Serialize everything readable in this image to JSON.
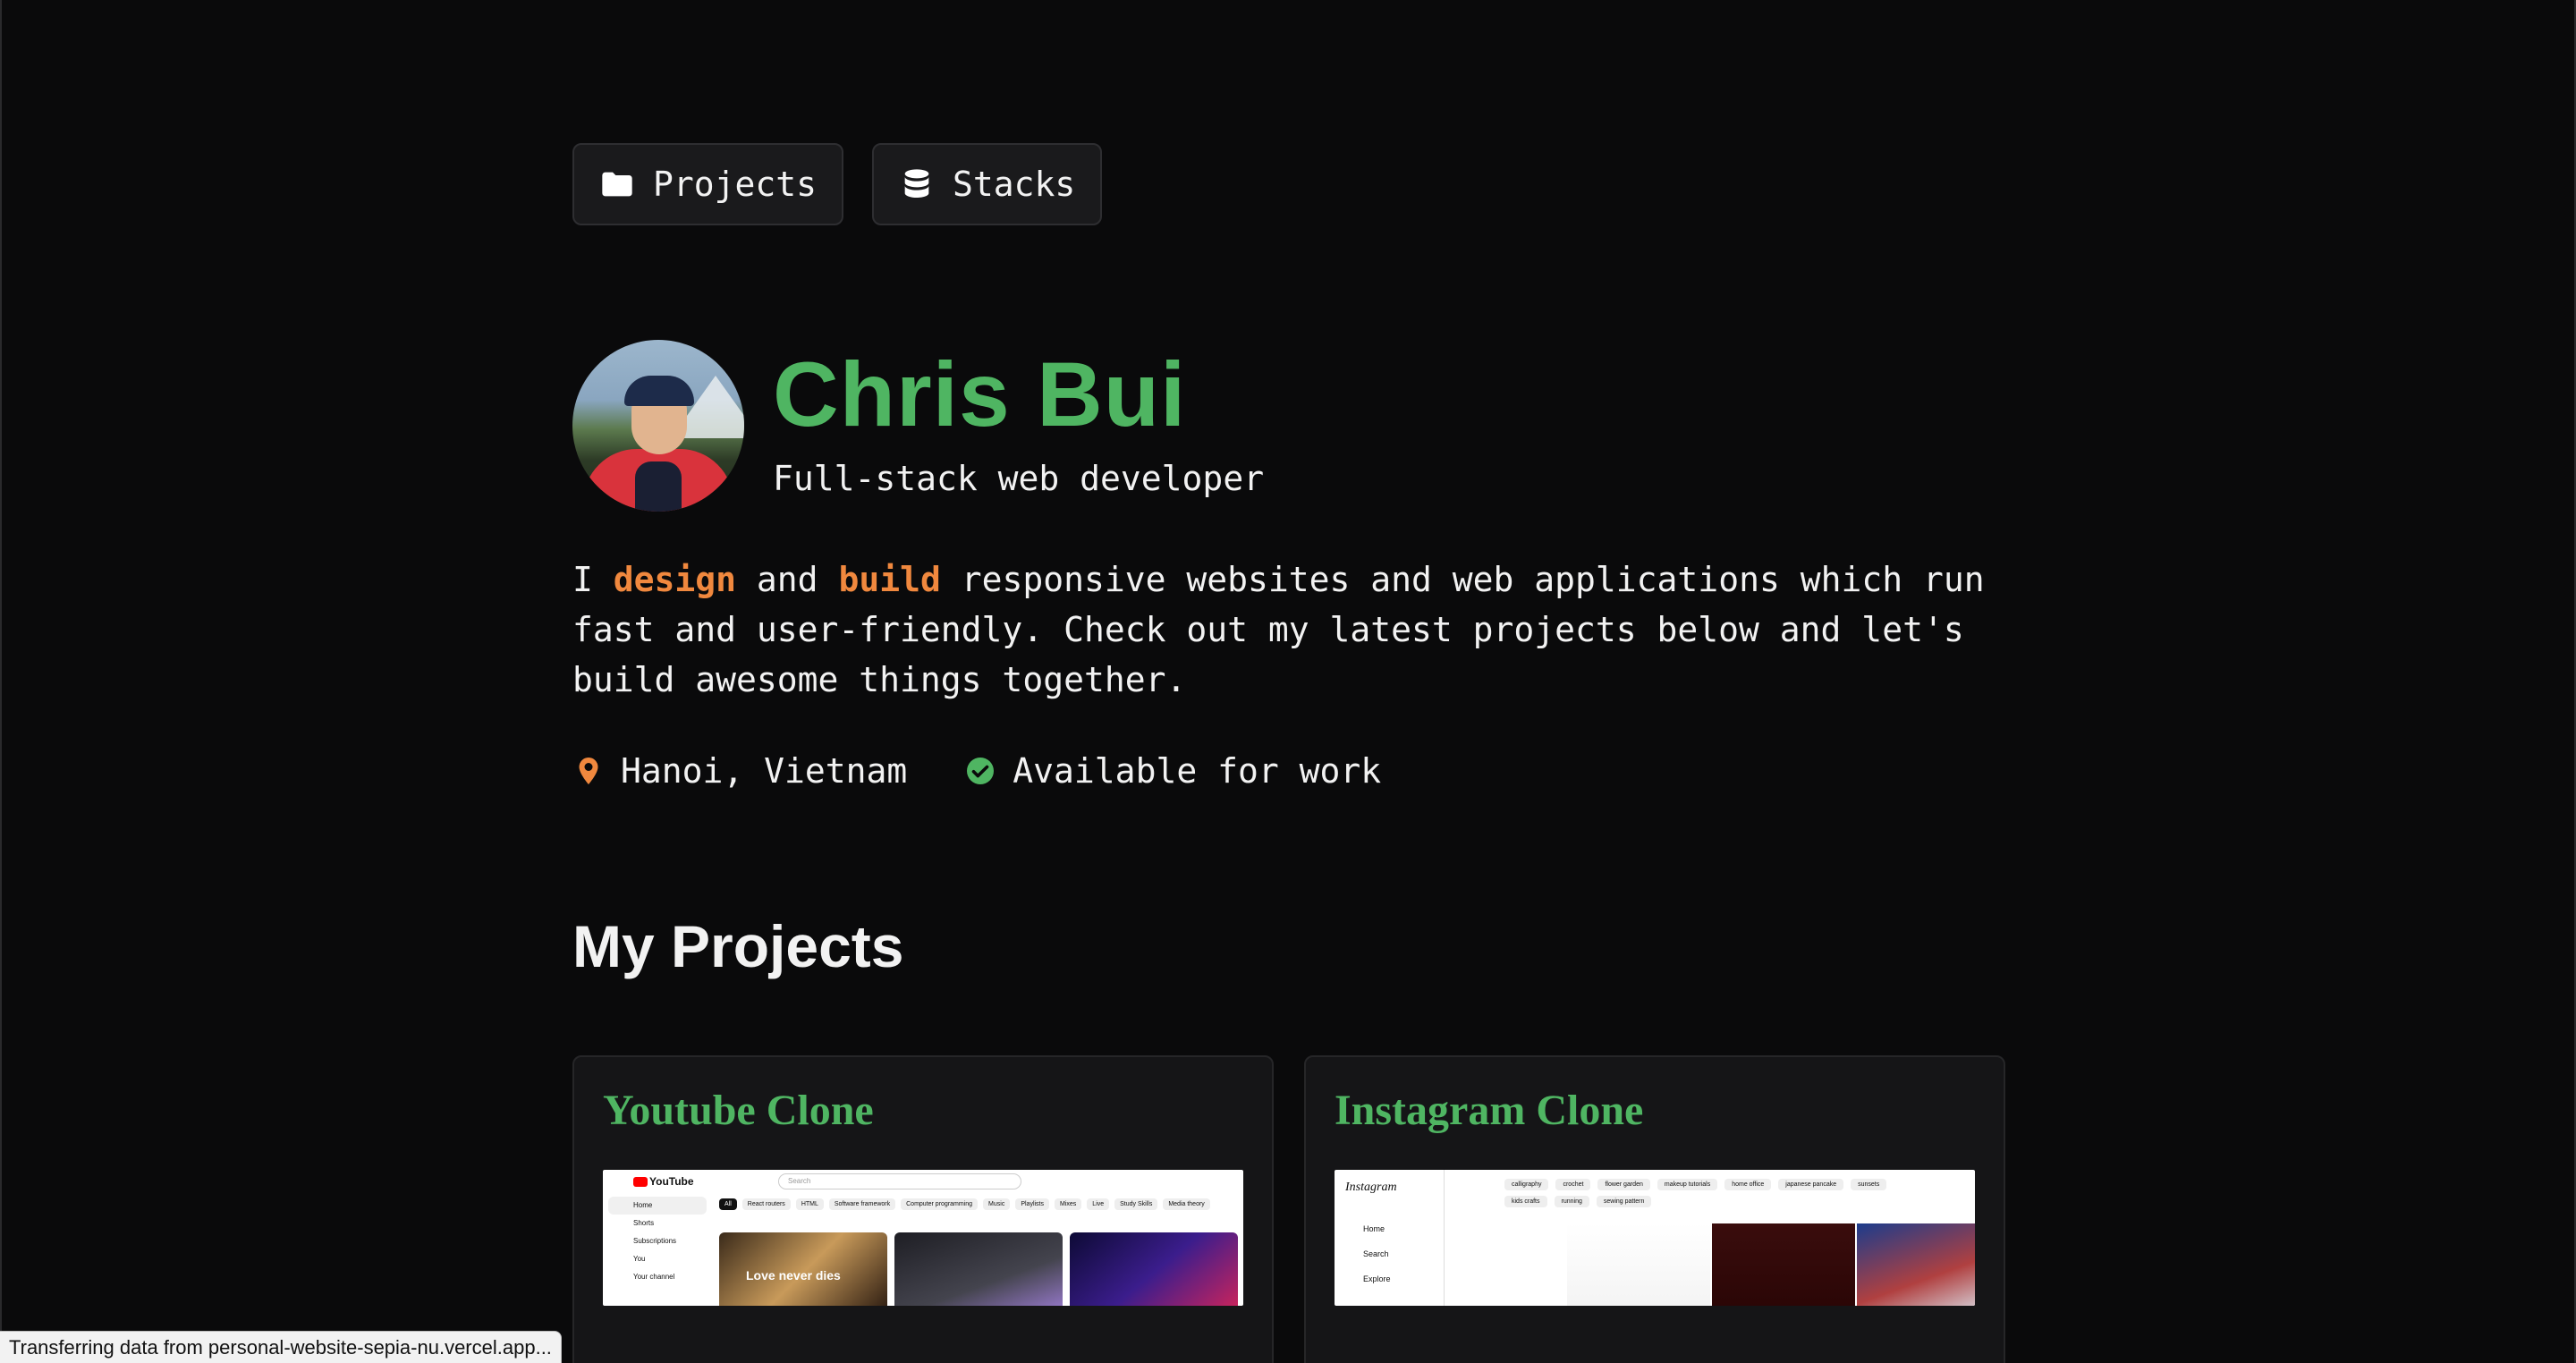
{
  "nav": {
    "projects_label": "Projects",
    "stacks_label": "Stacks"
  },
  "profile": {
    "name": "Chris Bui",
    "role": "Full-stack web developer",
    "intro_prefix": "I ",
    "intro_highlight_1": "design",
    "intro_and": " and ",
    "intro_highlight_2": "build",
    "intro_suffix": " responsive websites and web applications which run fast and user-friendly. Check out my latest projects below and let's build awesome things together.",
    "location": "Hanoi, Vietnam",
    "availability": "Available for work"
  },
  "projects": {
    "title": "My Projects",
    "items": [
      {
        "title": "Youtube Clone"
      },
      {
        "title": "Instagram Clone"
      }
    ]
  },
  "youtube_thumb": {
    "logo": "YouTube",
    "search_placeholder": "Search",
    "sidebar": [
      "Home",
      "Shorts",
      "Subscriptions",
      "You",
      "Your channel"
    ],
    "chips": [
      "All",
      "React routers",
      "HTML",
      "Software framework",
      "Computer programming",
      "Music",
      "Playlists",
      "Mixes",
      "Live",
      "Study Skills",
      "Media theory"
    ],
    "video_caption": "Love never dies"
  },
  "instagram_thumb": {
    "logo": "Instagram",
    "sidebar": [
      "Home",
      "Search",
      "Explore"
    ],
    "chips": [
      "calligraphy",
      "crochet",
      "flower garden",
      "makeup tutorials",
      "home office",
      "japanese pancake",
      "sunsets",
      "kids crafts",
      "running",
      "sewing pattern"
    ]
  },
  "status_bar": {
    "text": "Transferring data from personal-website-sepia-nu.vercel.app..."
  },
  "colors": {
    "background": "#0a0a0b",
    "accent_green": "#4fb562",
    "accent_orange": "#f0883e"
  },
  "icons": {
    "projects": "folder-icon",
    "stacks": "database-icon",
    "location": "map-pin-icon",
    "availability": "check-circle-icon"
  }
}
